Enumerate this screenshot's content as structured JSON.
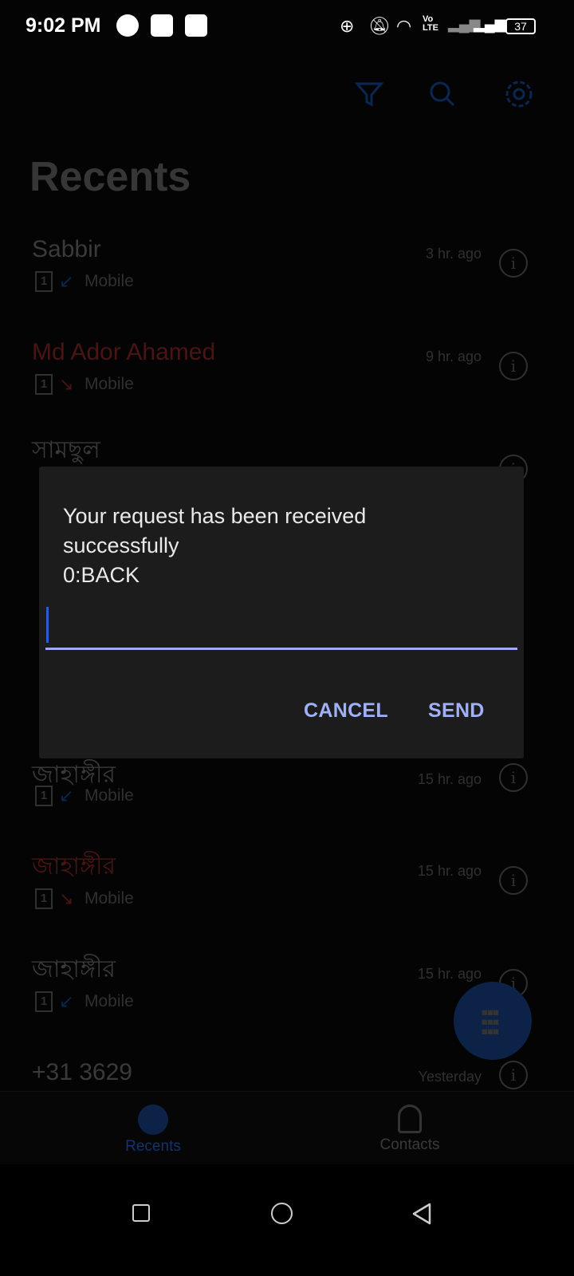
{
  "status_bar": {
    "time": "9:02 PM",
    "battery": "37"
  },
  "header": {
    "title": "Recents",
    "icons": [
      "filter-icon",
      "search-icon",
      "settings-icon"
    ]
  },
  "recents": [
    {
      "name": "Sabbir",
      "sim": "1",
      "direction": "incoming",
      "type": "Mobile",
      "time": "3 hr. ago",
      "missed": false
    },
    {
      "name": "Md Ador Ahamed",
      "sim": "1",
      "direction": "missed",
      "type": "Mobile",
      "time": "9 hr. ago",
      "missed": true
    },
    {
      "name": "সামছুল",
      "missed": false
    },
    {
      "name": "জাহাঙ্গীর",
      "sim": "1",
      "direction": "incoming",
      "type": "Mobile",
      "time": "15 hr. ago",
      "missed": false
    },
    {
      "name": "জাহাঙ্গীর",
      "sim": "1",
      "direction": "missed",
      "type": "Mobile",
      "time": "15 hr. ago",
      "missed": true
    },
    {
      "name": "জাহাঙ্গীর",
      "sim": "1",
      "direction": "incoming",
      "type": "Mobile",
      "time": "15 hr. ago",
      "missed": false
    },
    {
      "name": "+31 3629",
      "time": "Yesterday",
      "missed": false
    }
  ],
  "bottom_nav": {
    "recents": "Recents",
    "contacts": "Contacts"
  },
  "dialog": {
    "message": "Your request has been received\nsuccessfully\n0:BACK",
    "input_value": "",
    "cancel": "CANCEL",
    "send": "SEND"
  },
  "colors": {
    "accent": "#9fb0f7",
    "missed": "#e23a3a",
    "incoming": "#1e6fd9",
    "dialog_bg": "#1c1c1c"
  }
}
